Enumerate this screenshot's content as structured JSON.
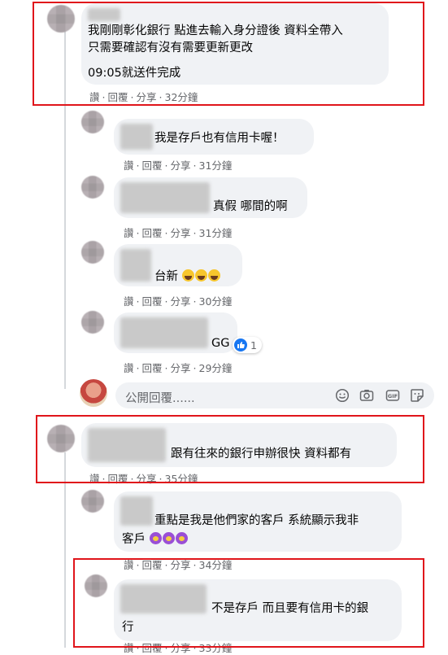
{
  "actions": {
    "like": "讚",
    "reply": "回覆",
    "share": "分享",
    "dot": "·"
  },
  "comments": [
    {
      "id": "c1",
      "lines": [
        "我剛剛彰化銀行 點進去輸入身分證後 資料全帶入",
        "只需要確認有沒有需要更新更改",
        "09:05就送件完成"
      ],
      "time": "32分鐘"
    },
    {
      "id": "r1",
      "text": "我是存戶也有信用卡喔！",
      "time": "31分鐘"
    },
    {
      "id": "r2",
      "text": "真假 哪間的啊",
      "time": "31分鐘"
    },
    {
      "id": "r3",
      "text": "台新",
      "time": "30分鐘"
    },
    {
      "id": "r4",
      "text": "GG",
      "time": "29分鐘",
      "reactions": "1"
    },
    {
      "id": "c2",
      "text": "跟有往來的銀行申辦很快 資料都有",
      "time": "35分鐘"
    },
    {
      "id": "r5",
      "lines": [
        "重點是我是他們家的客戶 系統顯示我非",
        "客戶"
      ],
      "time": "34分鐘"
    },
    {
      "id": "r6",
      "lines": [
        "不是存戶 而且要有信用卡的銀",
        "行"
      ],
      "time": "33分鐘"
    }
  ],
  "reply_input": {
    "placeholder": "公開回覆......"
  },
  "icons": [
    "emoji-icon",
    "camera-icon",
    "gif-icon",
    "sticker-icon",
    "like-reaction-icon"
  ],
  "colors": {
    "highlight": "#e0151b",
    "bubble": "#f0f2f5",
    "meta": "#65676b",
    "like": "#1877f2"
  }
}
